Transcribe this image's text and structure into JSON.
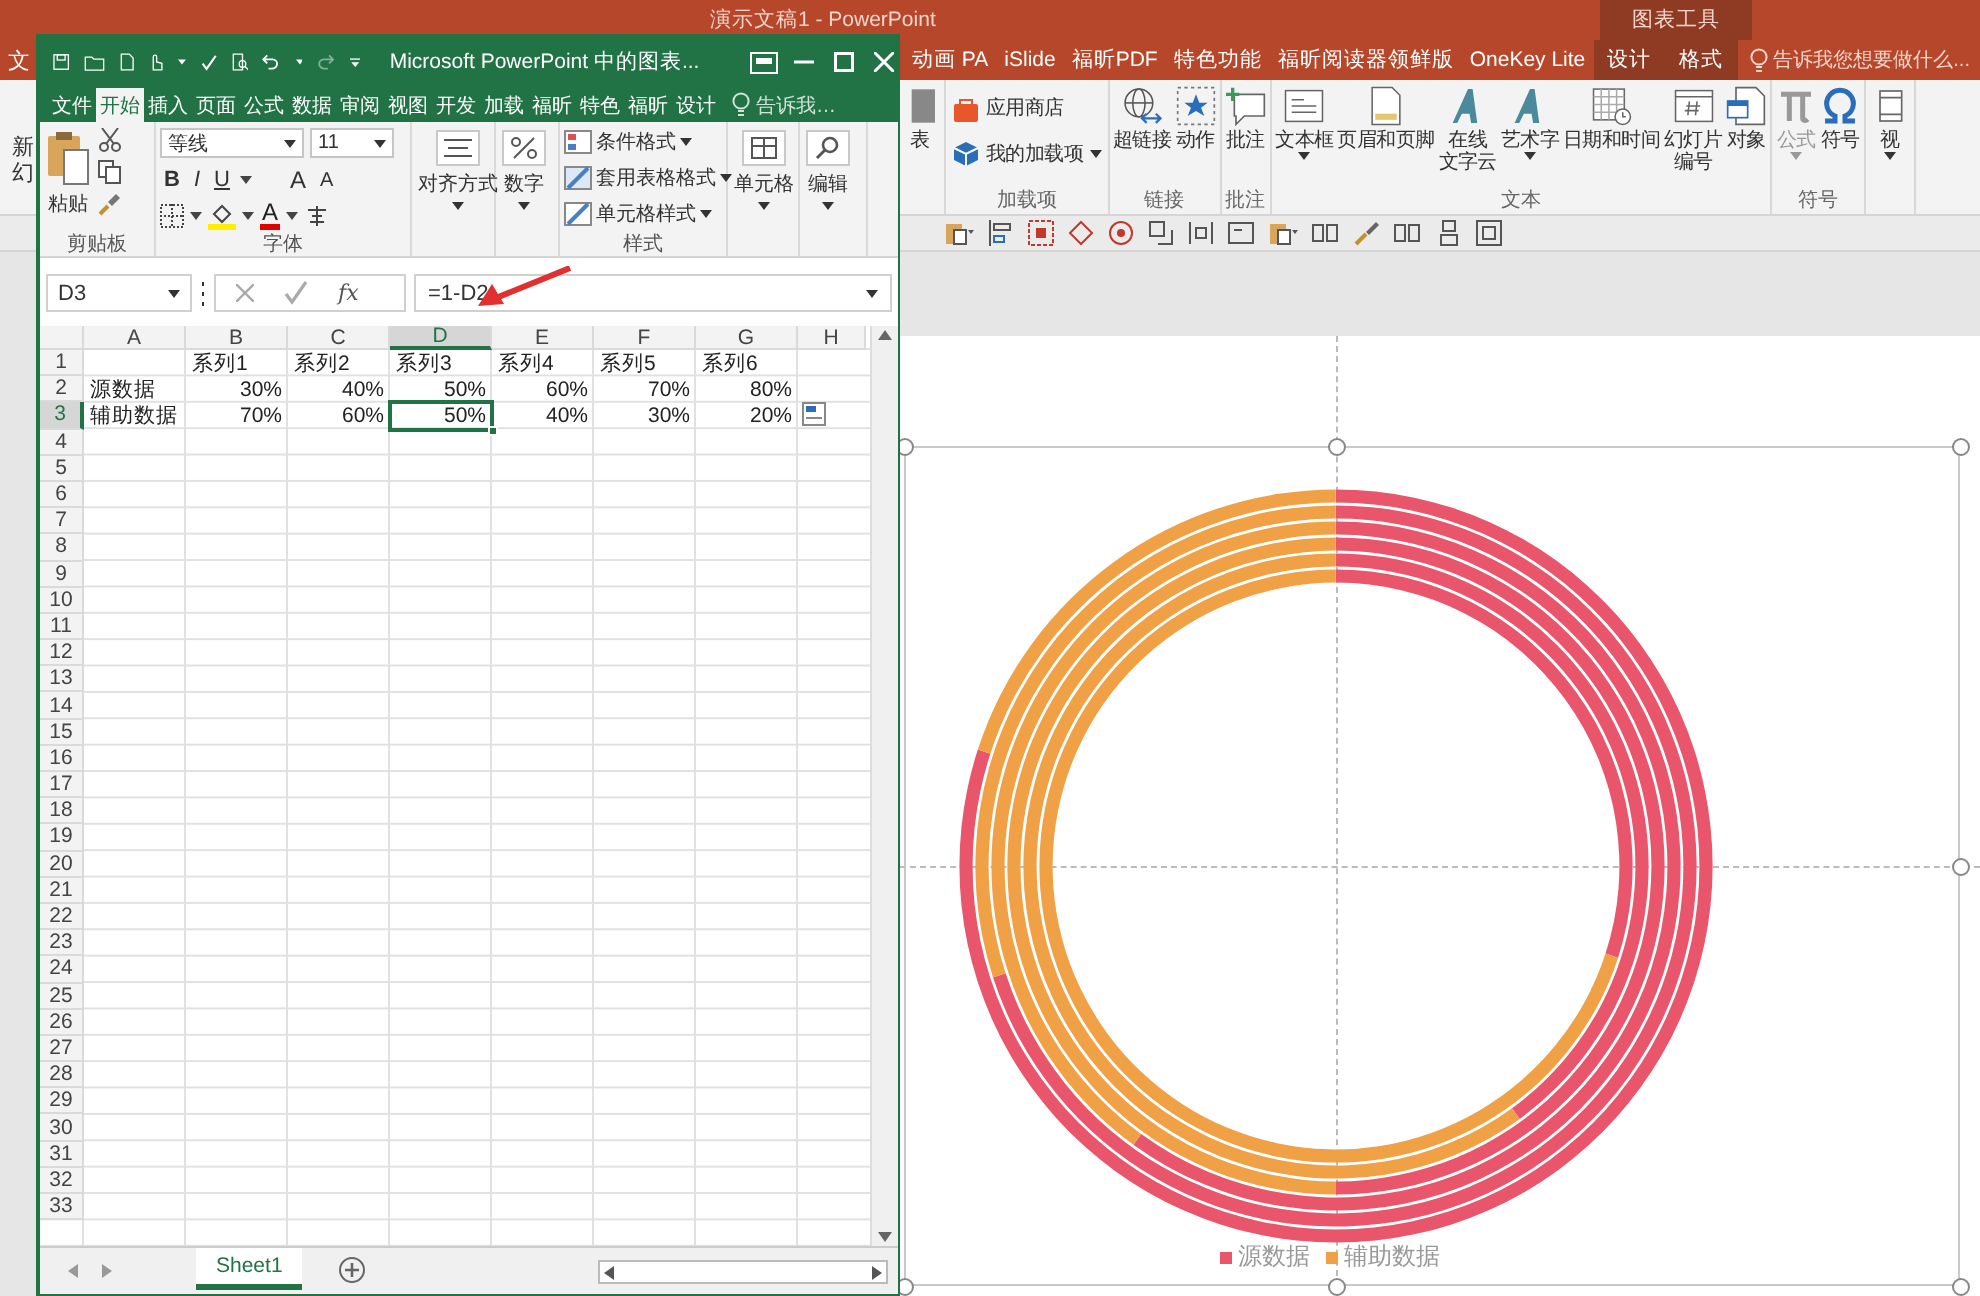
{
  "powerpoint": {
    "title": "演示文稿1 - PowerPoint",
    "context_group": "图表工具",
    "file_tab_fragment": "文",
    "new_slide_fragment": [
      "新",
      "幻"
    ],
    "tabs": [
      {
        "label": "动画 PA",
        "contextual": false,
        "selected": false
      },
      {
        "label": "iSlide",
        "contextual": false,
        "selected": false
      },
      {
        "label": "福昕PDF",
        "contextual": false,
        "selected": false
      },
      {
        "label": "特色功能",
        "contextual": false,
        "selected": false
      },
      {
        "label": "福昕阅读器领鲜版",
        "contextual": false,
        "selected": false
      },
      {
        "label": "OneKey Lite",
        "contextual": false,
        "selected": false
      },
      {
        "label": "设计",
        "contextual": true,
        "selected": false
      },
      {
        "label": "格式",
        "contextual": true,
        "selected": false
      }
    ],
    "tell_me": "告诉我您想要做什么...",
    "ribbon_groups": [
      {
        "buttons": [
          {
            "label": "表",
            "kind": "large",
            "dropdown": false,
            "disabled": false
          }
        ]
      },
      {
        "label": "加载项",
        "buttons": [
          {
            "label": "应用商店",
            "kind": "small",
            "dropdown": false,
            "disabled": false
          },
          {
            "label": "我的加载项",
            "kind": "small",
            "dropdown": true,
            "disabled": false
          }
        ]
      },
      {
        "label": "链接",
        "buttons": [
          {
            "label": "超链接",
            "kind": "large",
            "dropdown": false,
            "disabled": false
          },
          {
            "label": "动作",
            "kind": "large",
            "dropdown": false,
            "disabled": false
          }
        ]
      },
      {
        "label": "批注",
        "buttons": [
          {
            "label": "批注",
            "kind": "large",
            "dropdown": false,
            "disabled": false
          }
        ]
      },
      {
        "label": "文本",
        "buttons": [
          {
            "label": "文本框",
            "kind": "large",
            "dropdown": true,
            "disabled": false
          },
          {
            "label": "页眉和页脚",
            "kind": "large",
            "dropdown": false,
            "disabled": false
          },
          {
            "label_lines": [
              "在线",
              "文字云"
            ],
            "kind": "large",
            "dropdown": false,
            "disabled": false
          },
          {
            "label": "艺术字",
            "kind": "large",
            "dropdown": true,
            "disabled": false
          },
          {
            "label": "日期和时间",
            "kind": "large",
            "dropdown": false,
            "disabled": false
          },
          {
            "label_lines": [
              "幻灯片",
              "编号"
            ],
            "kind": "large",
            "dropdown": false,
            "disabled": false
          },
          {
            "label": "对象",
            "kind": "large",
            "dropdown": false,
            "disabled": false
          }
        ]
      },
      {
        "label": "符号",
        "buttons": [
          {
            "label": "公式",
            "kind": "large",
            "dropdown": true,
            "disabled": true
          },
          {
            "label": "符号",
            "kind": "large",
            "dropdown": false,
            "disabled": false
          }
        ]
      },
      {
        "buttons": [
          {
            "label": "视",
            "kind": "large",
            "dropdown": true,
            "disabled": false
          }
        ]
      }
    ],
    "chart": {
      "legend": [
        {
          "label": "源数据",
          "color": "#e9566b"
        },
        {
          "label": "辅助数据",
          "color": "#f0a045"
        }
      ]
    }
  },
  "excel": {
    "title": "Microsoft PowerPoint 中的图表...",
    "tabs": [
      {
        "label": "文件",
        "selected": false
      },
      {
        "label": "开始",
        "selected": true
      },
      {
        "label": "插入",
        "selected": false
      },
      {
        "label": "页面",
        "selected": false
      },
      {
        "label": "公式",
        "selected": false
      },
      {
        "label": "数据",
        "selected": false
      },
      {
        "label": "审阅",
        "selected": false
      },
      {
        "label": "视图",
        "selected": false
      },
      {
        "label": "开发",
        "selected": false
      },
      {
        "label": "加载",
        "selected": false
      },
      {
        "label": "福昕",
        "selected": false
      },
      {
        "label": "特色",
        "selected": false
      },
      {
        "label": "福昕",
        "selected": false
      },
      {
        "label": "设计",
        "selected": false
      }
    ],
    "tell_me": "告诉我…",
    "ribbon": {
      "paste": "粘贴",
      "clipboard_label": "剪贴板",
      "font_name": "等线",
      "font_size": "11",
      "style_buttons": [
        "B",
        "I",
        "U"
      ],
      "size_buttons": [
        "A",
        "A"
      ],
      "color_button": "A",
      "font_label": "字体",
      "alignment": "对齐方式",
      "number": "数字",
      "styles": [
        "条件格式",
        "套用表格格式",
        "单元格样式"
      ],
      "styles_label": "样式",
      "cells": "单元格",
      "editing": "编辑"
    },
    "formula_bar": {
      "name_box": "D3",
      "function_label": "fx",
      "formula": "=1-D2"
    },
    "columns": [
      {
        "label": "A",
        "selected": false
      },
      {
        "label": "B",
        "selected": false
      },
      {
        "label": "C",
        "selected": false
      },
      {
        "label": "D",
        "selected": true
      },
      {
        "label": "E",
        "selected": false
      },
      {
        "label": "F",
        "selected": false
      },
      {
        "label": "G",
        "selected": false
      },
      {
        "label": "H",
        "selected": false
      }
    ],
    "rows": [
      {
        "number": "1",
        "selected": false,
        "cells": [
          {
            "selected": false
          },
          {
            "text": "系列1",
            "kind": "text",
            "selected": false
          },
          {
            "text": "系列2",
            "kind": "text",
            "selected": false
          },
          {
            "text": "系列3",
            "kind": "text",
            "selected": false
          },
          {
            "text": "系列4",
            "kind": "text",
            "selected": false
          },
          {
            "text": "系列5",
            "kind": "text",
            "selected": false
          },
          {
            "text": "系列6",
            "kind": "text",
            "selected": false
          },
          {
            "selected": false
          }
        ]
      },
      {
        "number": "2",
        "selected": false,
        "cells": [
          {
            "text": "源数据",
            "kind": "text",
            "selected": false
          },
          {
            "text": "30%",
            "kind": "number",
            "selected": false
          },
          {
            "text": "40%",
            "kind": "number",
            "selected": false
          },
          {
            "text": "50%",
            "kind": "number",
            "selected": false
          },
          {
            "text": "60%",
            "kind": "number",
            "selected": false
          },
          {
            "text": "70%",
            "kind": "number",
            "selected": false
          },
          {
            "text": "80%",
            "kind": "number",
            "selected": false
          },
          {
            "selected": false
          }
        ]
      },
      {
        "number": "3",
        "selected": true,
        "cells": [
          {
            "text": "辅助数据",
            "kind": "text",
            "selected": false
          },
          {
            "text": "70%",
            "kind": "number",
            "selected": false
          },
          {
            "text": "60%",
            "kind": "number",
            "selected": false
          },
          {
            "text": "50%",
            "kind": "number",
            "selected": true
          },
          {
            "text": "40%",
            "kind": "number",
            "selected": false
          },
          {
            "text": "30%",
            "kind": "number",
            "selected": false
          },
          {
            "text": "20%",
            "kind": "number",
            "selected": false
          },
          {
            "selected": false
          }
        ]
      },
      {
        "number": "4",
        "selected": false
      },
      {
        "number": "5",
        "selected": false
      },
      {
        "number": "6",
        "selected": false
      },
      {
        "number": "7",
        "selected": false
      },
      {
        "number": "8",
        "selected": false
      },
      {
        "number": "9",
        "selected": false
      },
      {
        "number": "10",
        "selected": false
      },
      {
        "number": "11",
        "selected": false
      },
      {
        "number": "12",
        "selected": false
      },
      {
        "number": "13",
        "selected": false
      },
      {
        "number": "14",
        "selected": false
      },
      {
        "number": "15",
        "selected": false
      },
      {
        "number": "16",
        "selected": false
      },
      {
        "number": "17",
        "selected": false
      },
      {
        "number": "18",
        "selected": false
      },
      {
        "number": "19",
        "selected": false
      },
      {
        "number": "20",
        "selected": false
      },
      {
        "number": "21",
        "selected": false
      },
      {
        "number": "22",
        "selected": false
      },
      {
        "number": "23",
        "selected": false
      },
      {
        "number": "24",
        "selected": false
      },
      {
        "number": "25",
        "selected": false
      },
      {
        "number": "26",
        "selected": false
      },
      {
        "number": "27",
        "selected": false
      },
      {
        "number": "28",
        "selected": false
      },
      {
        "number": "29",
        "selected": false
      },
      {
        "number": "30",
        "selected": false
      },
      {
        "number": "31",
        "selected": false
      },
      {
        "number": "32",
        "selected": false
      },
      {
        "number": "33",
        "selected": false
      }
    ],
    "sheet_tabs": [
      {
        "label": "Sheet1",
        "selected": true
      }
    ]
  }
}
